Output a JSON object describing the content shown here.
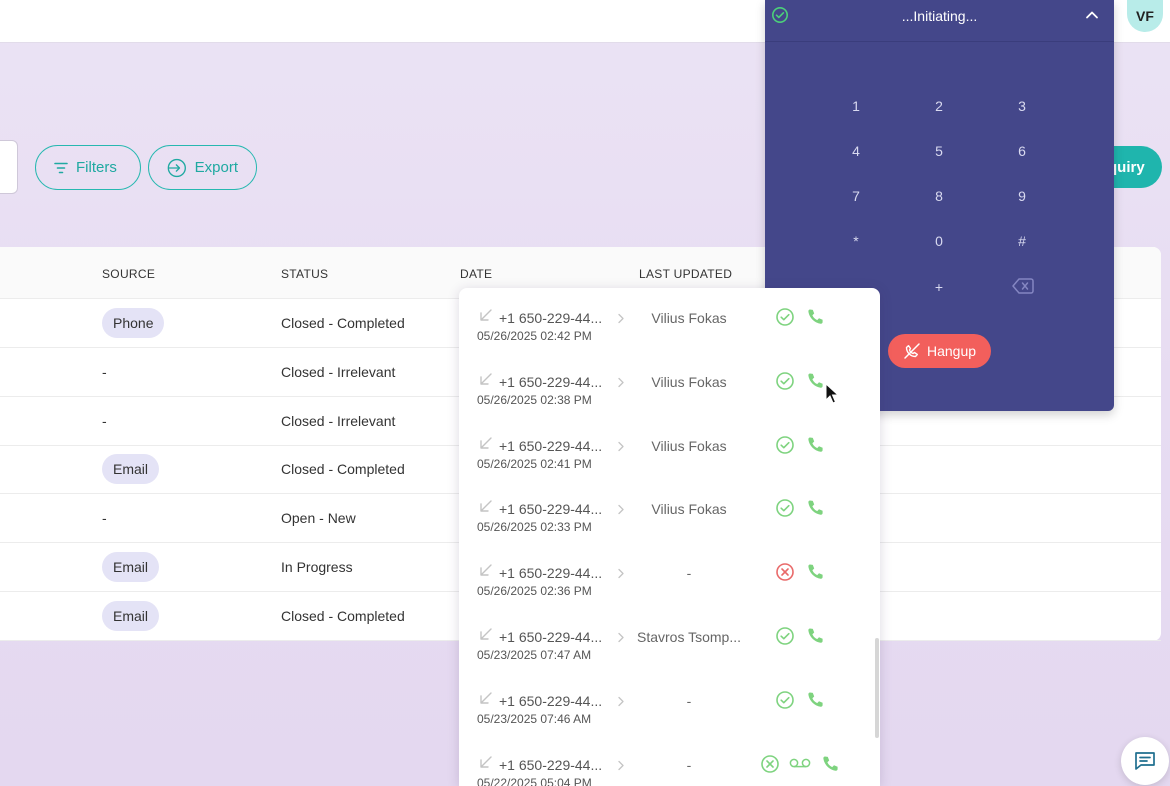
{
  "header": {
    "avatar_initials": "VF"
  },
  "toolbar": {
    "filters_label": "Filters",
    "export_label": "Export",
    "inquiry_label": "quiry"
  },
  "table": {
    "columns": {
      "source": "SOURCE",
      "status": "STATUS",
      "date": "DATE",
      "last_updated": "LAST UPDATED"
    },
    "rows": [
      {
        "source": "Phone",
        "source_chip": true,
        "status": "Closed - Completed"
      },
      {
        "source": "-",
        "source_chip": false,
        "status": "Closed - Irrelevant"
      },
      {
        "source": "-",
        "source_chip": false,
        "status": "Closed - Irrelevant"
      },
      {
        "source": "Email",
        "source_chip": true,
        "status": "Closed - Completed"
      },
      {
        "source": "-",
        "source_chip": false,
        "status": "Open - New"
      },
      {
        "source": "Email",
        "source_chip": true,
        "status": "In Progress"
      },
      {
        "source": "Email",
        "source_chip": true,
        "status": "Closed - Completed"
      }
    ]
  },
  "dialer": {
    "status": "...Initiating...",
    "keys": [
      "1",
      "2",
      "3",
      "4",
      "5",
      "6",
      "7",
      "8",
      "9",
      "*",
      "0",
      "#",
      "+"
    ],
    "hangup_label": "Hangup"
  },
  "call_history": [
    {
      "number": "+1 650-229-44...",
      "date": "05/26/2025 02:42 PM",
      "agent": "Vilius Fokas",
      "result": "success",
      "voicemail": false
    },
    {
      "number": "+1 650-229-44...",
      "date": "05/26/2025 02:38 PM",
      "agent": "Vilius Fokas",
      "result": "success",
      "voicemail": false
    },
    {
      "number": "+1 650-229-44...",
      "date": "05/26/2025 02:41 PM",
      "agent": "Vilius Fokas",
      "result": "success",
      "voicemail": false
    },
    {
      "number": "+1 650-229-44...",
      "date": "05/26/2025 02:33 PM",
      "agent": "Vilius Fokas",
      "result": "success",
      "voicemail": false
    },
    {
      "number": "+1 650-229-44...",
      "date": "05/26/2025 02:36 PM",
      "agent": "-",
      "result": "failed",
      "voicemail": false
    },
    {
      "number": "+1 650-229-44...",
      "date": "05/23/2025 07:47 AM",
      "agent": "Stavros Tsomp...",
      "result": "success",
      "voicemail": false
    },
    {
      "number": "+1 650-229-44...",
      "date": "05/23/2025 07:46 AM",
      "agent": "-",
      "result": "success",
      "voicemail": false
    },
    {
      "number": "+1 650-229-44...",
      "date": "05/22/2025 05:04 PM",
      "agent": "-",
      "result": "missed",
      "voicemail": true
    }
  ],
  "colors": {
    "accent": "#1fb5ad",
    "dialer_bg": "#44478a",
    "hangup": "#f25f5c",
    "success": "#7ed37f",
    "error": "#e96a6a"
  },
  "icons": {
    "filters": "filter-icon",
    "export": "export-icon",
    "dialer_connected": "check-circle-icon",
    "collapse": "chevron-up-icon",
    "backspace": "backspace-icon",
    "hangup": "phone-off-icon",
    "direction": "incoming-arrow-icon",
    "call": "phone-icon",
    "voicemail": "voicemail-icon",
    "chat": "chat-icon"
  }
}
